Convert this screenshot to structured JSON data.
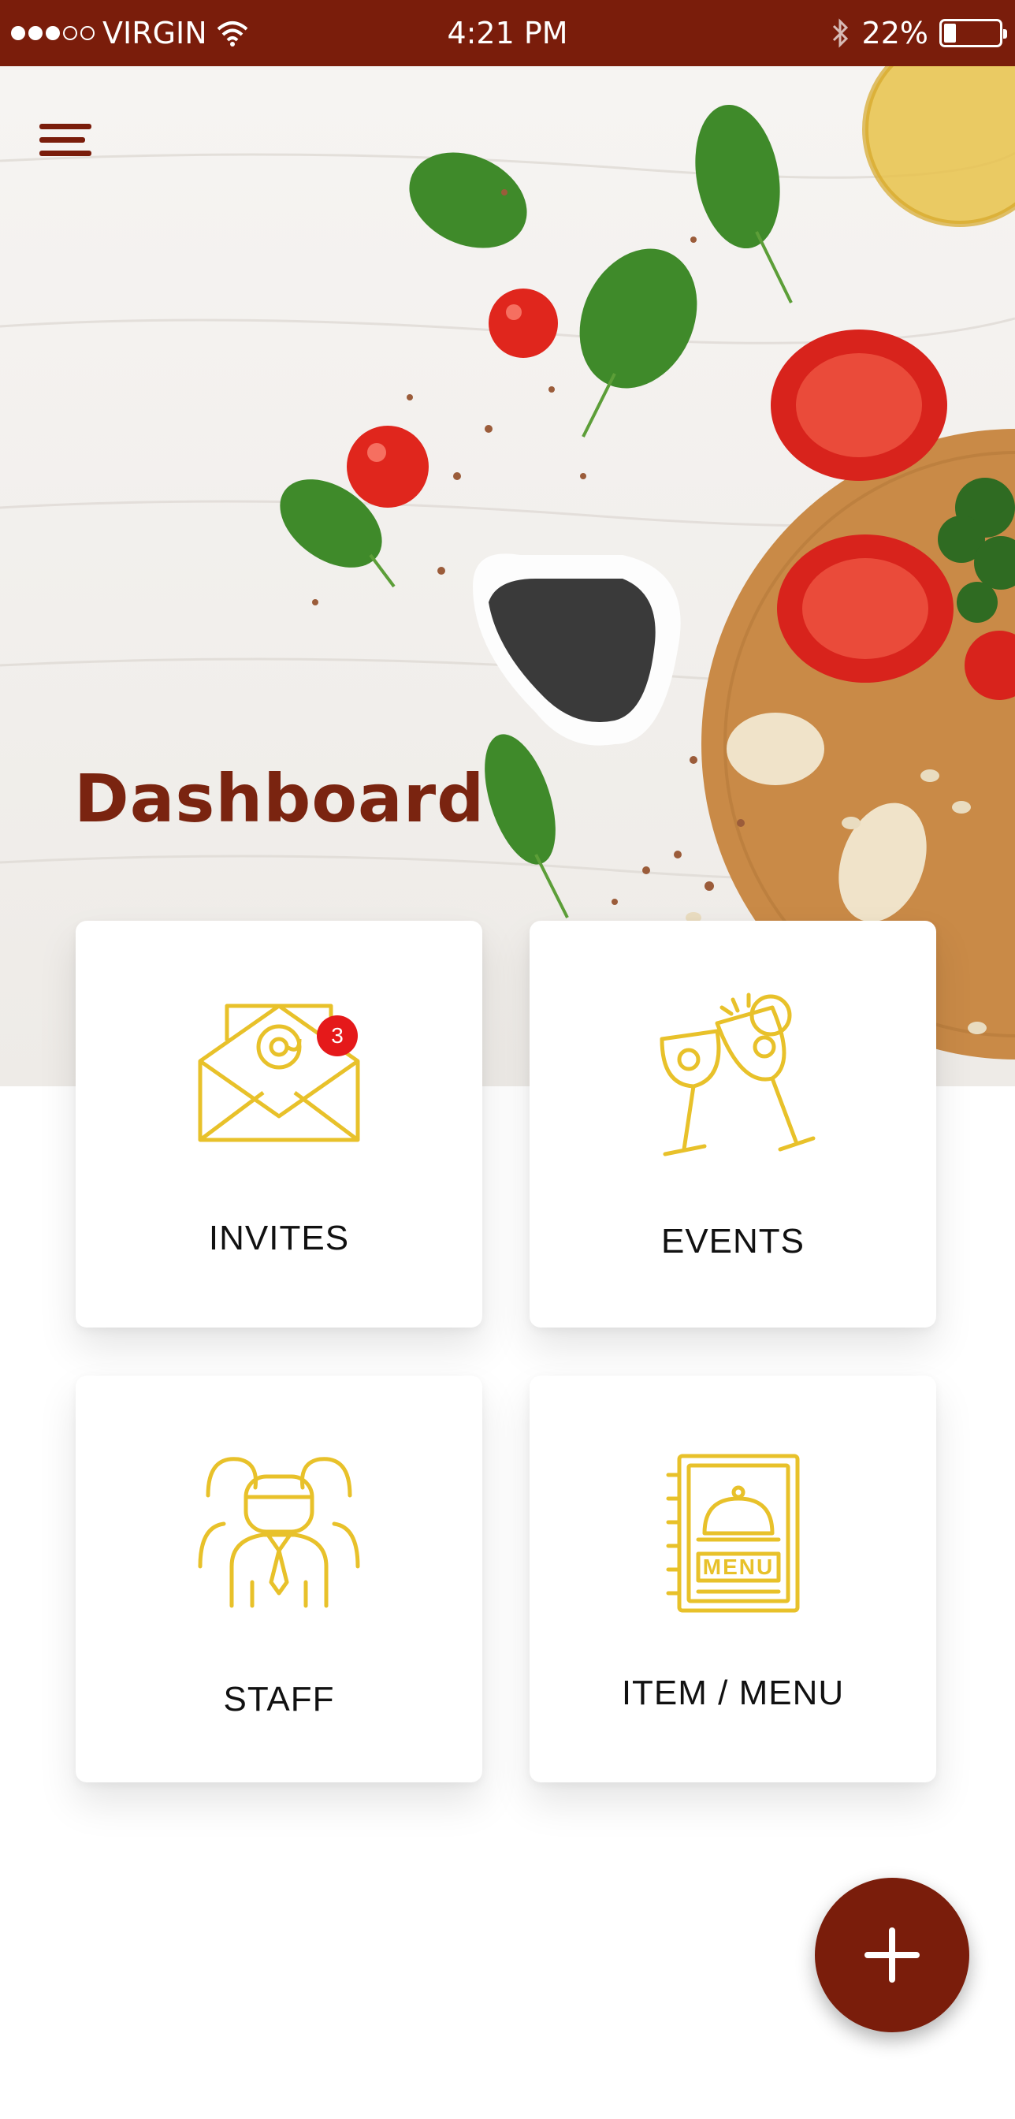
{
  "status_bar": {
    "carrier": "VIRGIN",
    "time": "4:21 PM",
    "battery": "22%",
    "battery_level": 0.22,
    "signal_bars": 3,
    "signal_max": 5
  },
  "header": {
    "title": "Dashboard",
    "menu_icon": "hamburger-menu-icon"
  },
  "tiles": [
    {
      "label": "INVITES",
      "icon": "envelope-email-icon",
      "badge": "3"
    },
    {
      "label": "EVENTS",
      "icon": "cocktail-toast-icon"
    },
    {
      "label": "STAFF",
      "icon": "staff-group-icon"
    },
    {
      "label": "ITEM / MENU",
      "icon": "menu-book-icon"
    }
  ],
  "fab": {
    "icon": "plus-icon"
  },
  "colors": {
    "brand": "#7a1d0b",
    "accent": "#e8c12a",
    "badge": "#e5191a"
  }
}
